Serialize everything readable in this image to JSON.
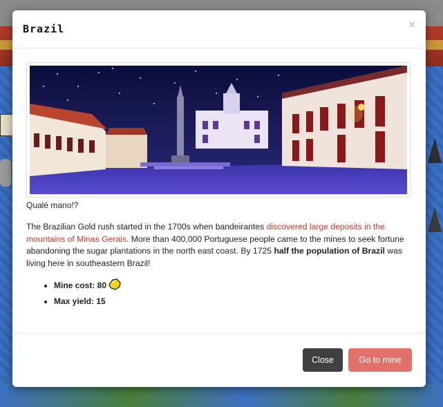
{
  "modal": {
    "title": "Brazil",
    "close_symbol": "×",
    "caption": "Qualé mano!?",
    "description": {
      "part1": "The Brazilian Gold rush started in the 1700s when bandeirantes ",
      "link": "discovered large deposits in the mountains of Minas Gerais",
      "part2": ". More than 400,000 Portuguese people came to the mines to seek fortune abandoning the sugar plantations in the north east coast. By 1725 ",
      "bold": "half the population of Brazil",
      "part3": " was living here in southeastern Brazil!"
    },
    "stats": {
      "mine_cost": "Mine cost: 80",
      "max_yield": "Max yield: 15"
    },
    "coin_icon": "gold-nugget-icon",
    "buttons": {
      "close": "Close",
      "go": "Go to mine"
    }
  },
  "colors": {
    "link": "#c0392b",
    "close_button": "#3f3f3f",
    "go_button": "#e2716a"
  }
}
